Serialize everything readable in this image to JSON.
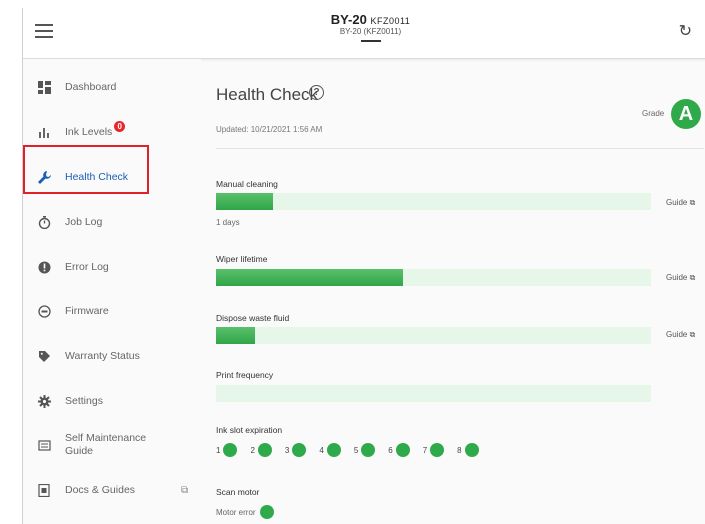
{
  "header": {
    "model": "BY-20",
    "serial": "KFZ0011",
    "subtitle": "BY-20 (KFZ0011)"
  },
  "sidebar": {
    "items": [
      {
        "label": "Dashboard",
        "icon": "dashboard-icon"
      },
      {
        "label": "Ink Levels",
        "icon": "bar-chart-icon",
        "badge": "0"
      },
      {
        "label": "Health Check",
        "icon": "wrench-icon",
        "active": true
      },
      {
        "label": "Job Log",
        "icon": "stopwatch-icon"
      },
      {
        "label": "Error Log",
        "icon": "alert-icon"
      },
      {
        "label": "Firmware",
        "icon": "firmware-icon"
      },
      {
        "label": "Warranty Status",
        "icon": "tag-icon"
      },
      {
        "label": "Settings",
        "icon": "gear-icon"
      },
      {
        "label_line1": "Self Maintenance",
        "label_line2": "Guide",
        "icon": "manual-icon"
      },
      {
        "label": "Docs & Guides",
        "icon": "document-icon",
        "external": true
      }
    ]
  },
  "main": {
    "title": "Health Check",
    "updated": "Updated: 10/21/2021 1:56 AM",
    "grade_label": "Grade",
    "grade": "A",
    "guide_label": "Guide",
    "metrics": {
      "manual_cleaning": {
        "label": "Manual cleaning",
        "fill": 0.13,
        "note": "1 days"
      },
      "wiper_lifetime": {
        "label": "Wiper lifetime",
        "fill": 0.43
      },
      "dispose_waste_fluid": {
        "label": "Dispose waste fluid",
        "fill": 0.09
      },
      "print_frequency": {
        "label": "Print frequency",
        "fill": 0.0
      }
    },
    "ink_slot": {
      "label": "Ink slot expiration",
      "slots": [
        "1",
        "2",
        "3",
        "4",
        "5",
        "6",
        "7",
        "8"
      ]
    },
    "scan_motor": {
      "label": "Scan motor",
      "status": "Motor error"
    }
  },
  "colors": {
    "accent_green": "#2eaa4a",
    "track_green": "#e6f6e8",
    "active_blue": "#1b5fb5",
    "highlight_red": "#e0202a",
    "badge_red": "#e8262e"
  }
}
